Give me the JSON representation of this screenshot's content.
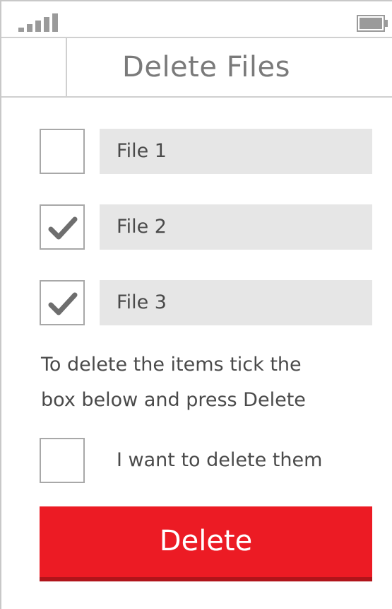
{
  "header": {
    "title": "Delete Files"
  },
  "files": [
    {
      "label": "File 1",
      "checked": false
    },
    {
      "label": "File 2",
      "checked": true
    },
    {
      "label": "File 3",
      "checked": true
    }
  ],
  "instructions": {
    "line1": "To delete the items tick the",
    "line2": "box below and press Delete"
  },
  "confirm": {
    "label": "I want to delete them",
    "checked": false
  },
  "actions": {
    "delete_label": "Delete"
  },
  "colors": {
    "accent": "#ec1b24",
    "field_bg": "#e6e6e6",
    "check_mark": "#6e6e6e"
  },
  "icons": {
    "signal": "signal-strength-icon",
    "battery": "battery-icon",
    "check": "checkmark-icon"
  }
}
